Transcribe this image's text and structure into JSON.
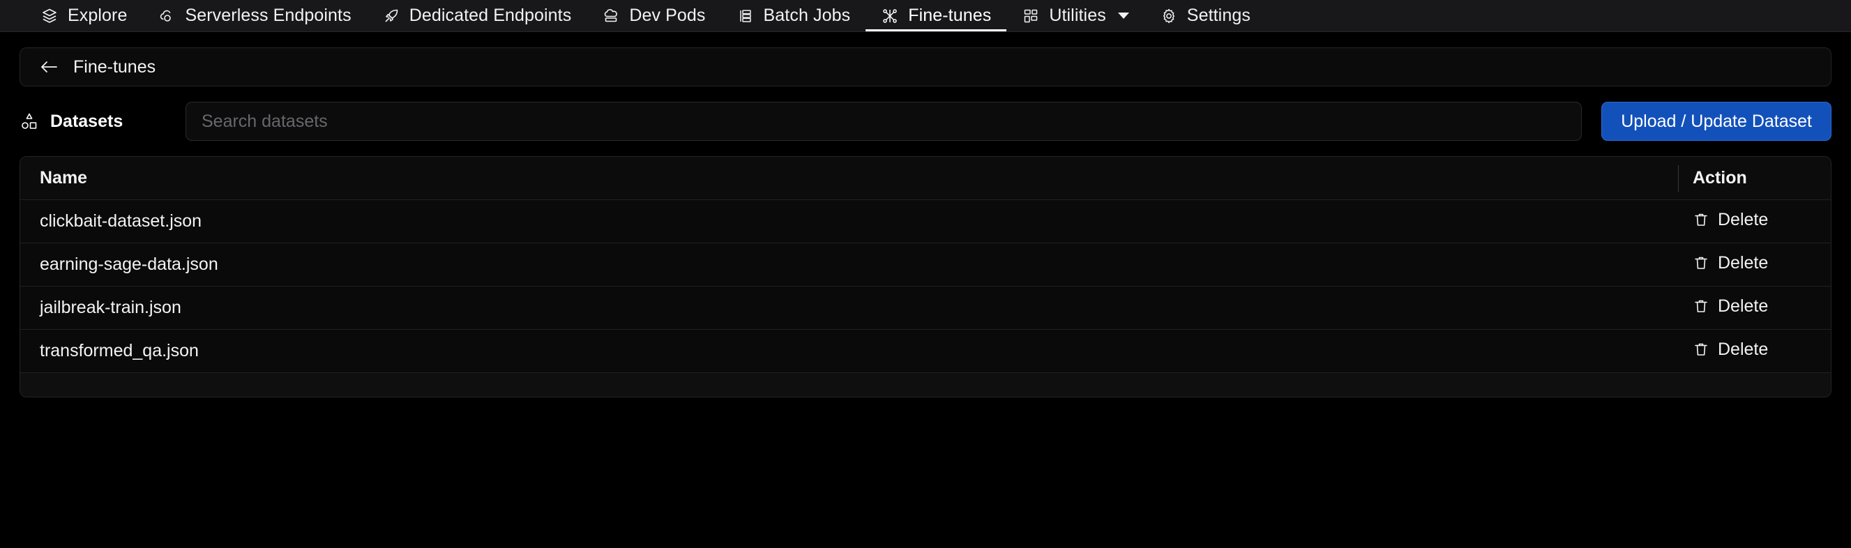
{
  "topnav": {
    "items": [
      {
        "label": "Explore",
        "icon": "layers-icon",
        "active": false,
        "caret": false
      },
      {
        "label": "Serverless Endpoints",
        "icon": "cloud-icon",
        "active": false,
        "caret": false
      },
      {
        "label": "Dedicated Endpoints",
        "icon": "rocket-icon",
        "active": false,
        "caret": false
      },
      {
        "label": "Dev Pods",
        "icon": "pod-icon",
        "active": false,
        "caret": false
      },
      {
        "label": "Batch Jobs",
        "icon": "stack-icon",
        "active": false,
        "caret": false
      },
      {
        "label": "Fine-tunes",
        "icon": "finetune-icon",
        "active": true,
        "caret": false
      },
      {
        "label": "Utilities",
        "icon": "grid-icon",
        "active": false,
        "caret": true
      },
      {
        "label": "Settings",
        "icon": "gear-icon",
        "active": false,
        "caret": false
      }
    ]
  },
  "breadcrumb": {
    "back_icon": "arrow-left-icon",
    "label": "Fine-tunes"
  },
  "toolbar": {
    "datasets_icon": "shapes-icon",
    "datasets_label": "Datasets",
    "search_placeholder": "Search datasets",
    "search_value": "",
    "upload_label": "Upload / Update Dataset",
    "upload_color": "#1351ba"
  },
  "table": {
    "columns": [
      "Name",
      "Action"
    ],
    "rows": [
      {
        "name": "clickbait-dataset.json",
        "action_label": "Delete",
        "action_icon": "trash-icon"
      },
      {
        "name": "earning-sage-data.json",
        "action_label": "Delete",
        "action_icon": "trash-icon"
      },
      {
        "name": "jailbreak-train.json",
        "action_label": "Delete",
        "action_icon": "trash-icon"
      },
      {
        "name": "transformed_qa.json",
        "action_label": "Delete",
        "action_icon": "trash-icon"
      }
    ]
  }
}
